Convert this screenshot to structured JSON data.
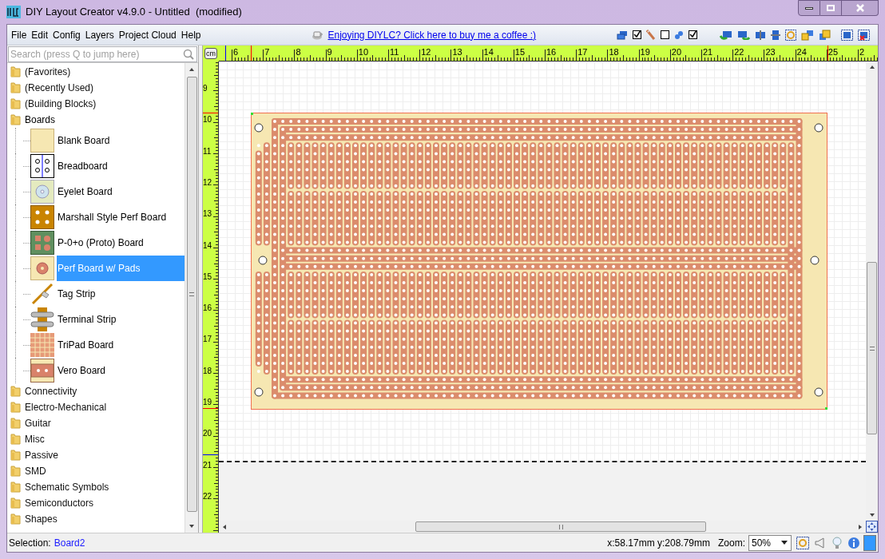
{
  "window": {
    "title": "DIY Layout Creator v4.9.0 - Untitled  (modified)"
  },
  "menu": [
    "File",
    "Edit",
    "Config",
    "Layers",
    "Project Cloud",
    "Help"
  ],
  "promo_link": "Enjoying DIYLC? Click here to buy me a coffee :)",
  "search": {
    "placeholder": "Search (press Q to jump here)"
  },
  "tree": [
    {
      "label": "(Favorites)",
      "expanded": false
    },
    {
      "label": "(Recently Used)",
      "expanded": false
    },
    {
      "label": "(Building Blocks)",
      "expanded": false
    },
    {
      "label": "Boards",
      "expanded": true,
      "children": [
        {
          "label": "Blank Board",
          "selected": false
        },
        {
          "label": "Breadboard",
          "selected": false
        },
        {
          "label": "Eyelet Board",
          "selected": false
        },
        {
          "label": "Marshall Style Perf Board",
          "selected": false
        },
        {
          "label": "P-0+o (Proto) Board",
          "selected": false
        },
        {
          "label": "Perf Board w/ Pads",
          "selected": true
        },
        {
          "label": "Tag Strip",
          "selected": false
        },
        {
          "label": "Terminal Strip",
          "selected": false
        },
        {
          "label": "TriPad Board",
          "selected": false
        },
        {
          "label": "Vero Board",
          "selected": false
        }
      ]
    },
    {
      "label": "Connectivity",
      "expanded": false
    },
    {
      "label": "Electro-Mechanical",
      "expanded": false
    },
    {
      "label": "Guitar",
      "expanded": false
    },
    {
      "label": "Misc",
      "expanded": false
    },
    {
      "label": "Passive",
      "expanded": false
    },
    {
      "label": "SMD",
      "expanded": false
    },
    {
      "label": "Schematic Symbols",
      "expanded": false
    },
    {
      "label": "Semiconductors",
      "expanded": false
    },
    {
      "label": "Shapes",
      "expanded": false
    }
  ],
  "ruler": {
    "unit": "cm",
    "x_labels": [
      "6",
      "7",
      "8",
      "9",
      "10",
      "11",
      "12",
      "13",
      "14",
      "15",
      "16",
      "17",
      "18",
      "19",
      "20",
      "21",
      "22",
      "23",
      "24",
      "25",
      "2"
    ],
    "y_labels": [
      "9",
      "10",
      "11",
      "12",
      "13",
      "14",
      "15",
      "16",
      "17",
      "18",
      "19",
      "20",
      "21",
      "22"
    ]
  },
  "status_bar": {
    "selection_label": "Selection:",
    "selection_value": "Board2",
    "coordinates": "x:58.17mm y:208.79mm",
    "zoom_label": "Zoom:",
    "zoom_value": "50%"
  }
}
